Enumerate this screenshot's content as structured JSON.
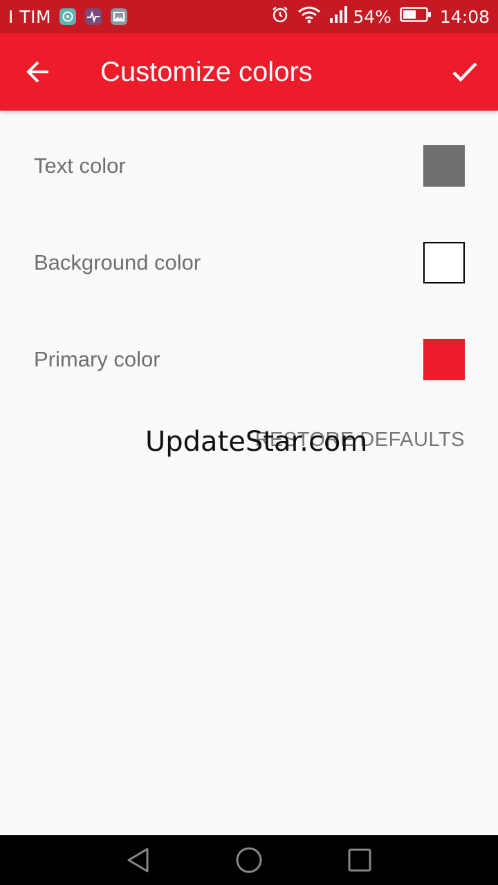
{
  "status_bar": {
    "carrier": "I TIM",
    "battery": "54%",
    "time": "14:08",
    "icons": [
      "chat-bubble-icon",
      "heartbeat-icon",
      "gallery-icon",
      "alarm-icon",
      "wifi-icon",
      "signal-icon",
      "battery-icon"
    ]
  },
  "app_bar": {
    "title": "Customize colors",
    "back_icon": "arrow-back-icon",
    "confirm_icon": "check-icon",
    "background": "#ec1c2a"
  },
  "settings": [
    {
      "label": "Text color",
      "swatch_color": "#707070"
    },
    {
      "label": "Background color",
      "swatch_color": "#ffffff"
    },
    {
      "label": "Primary color",
      "swatch_color": "#ec1c2a"
    }
  ],
  "restore_button": "RESTORE DEFAULTS",
  "watermark": "UpdateStar.com",
  "nav_bar": {
    "icons": [
      "back-triangle-icon",
      "home-circle-icon",
      "recents-square-icon"
    ]
  }
}
